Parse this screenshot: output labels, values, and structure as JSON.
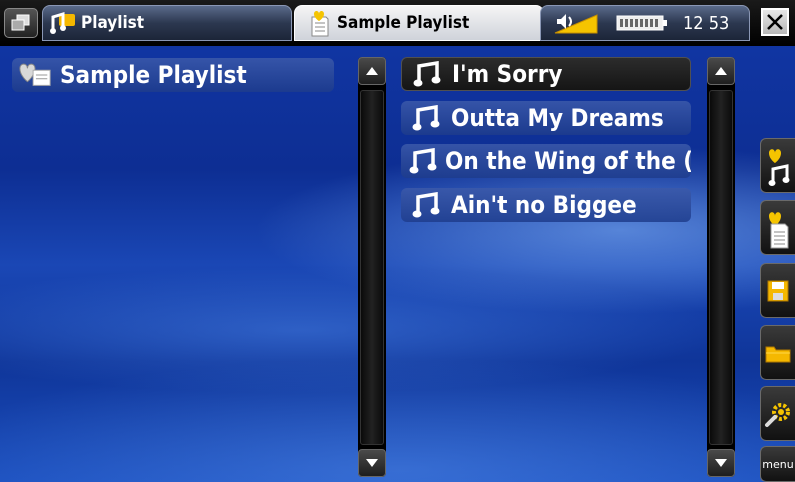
{
  "tabs": [
    {
      "label": "Playlist",
      "icon": "music-folder-icon"
    },
    {
      "label": "Sample Playlist",
      "icon": "playlist-doc-icon"
    }
  ],
  "status": {
    "clock": "12 53",
    "volume_icon": "speaker-volume-icon",
    "battery_icon": "battery-icon"
  },
  "left_panel": {
    "items": [
      {
        "label": "Sample Playlist",
        "icon": "playlist-heart-icon"
      }
    ]
  },
  "right_panel": {
    "items": [
      {
        "label": "I'm Sorry",
        "icon": "music-note-icon"
      },
      {
        "label": "Outta My Dreams",
        "icon": "music-note-icon"
      },
      {
        "label": "On the Wing of the (",
        "icon": "music-note-icon"
      },
      {
        "label": "Ain't no Biggee",
        "icon": "music-note-icon"
      }
    ]
  },
  "side_menu": {
    "buttons": [
      "add-to-playlist-icon",
      "playlist-doc-icon",
      "save-icon",
      "folder-icon",
      "tools-icon"
    ],
    "menu_label": "menu"
  },
  "colors": {
    "accent": "#f5c400",
    "background": "#1238a8"
  }
}
